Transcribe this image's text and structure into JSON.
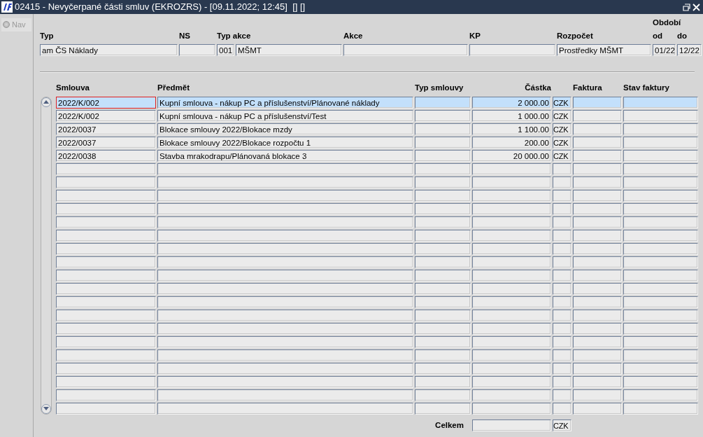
{
  "window": {
    "title": "02415 - Nevyčerpané části smluv (EKROZRS) - [09.11.2022; 12:45]  [] []"
  },
  "nav": {
    "label": "Nav",
    "disabled": true
  },
  "filter": {
    "period_label": "Období",
    "fields": [
      {
        "label": "Typ",
        "value": "am ČS Náklady"
      },
      {
        "label": "NS"
      },
      {
        "label": "Typ akce",
        "code": "001",
        "value": "MŠMT"
      },
      {
        "label": "Akce"
      },
      {
        "label": "KP"
      },
      {
        "label": "Rozpočet",
        "value": "Prostředky MŠMT"
      },
      {
        "label": "od",
        "value": "01/22"
      },
      {
        "label": "do",
        "value": "12/22"
      }
    ]
  },
  "table": {
    "columns": [
      {
        "label": "Smlouva"
      },
      {
        "label": "Předmět"
      },
      {
        "label": "Typ smlouvy"
      },
      {
        "label": "Částka"
      },
      {
        "label": "Faktura"
      },
      {
        "label": "Stav faktury"
      }
    ],
    "rows": [
      {
        "contract": "2022/K/002",
        "subject": "Kupní smlouva - nákup PC a příslušenství/Plánované náklady",
        "amount": "2 000.00",
        "currency": "CZK",
        "selected": true
      },
      {
        "contract": "2022/K/002",
        "subject": "Kupní smlouva - nákup PC a příslušenství/Test",
        "amount": "1 000.00",
        "currency": "CZK",
        "selected": false
      },
      {
        "contract": "2022/0037",
        "subject": "Blokace smlouvy 2022/Blokace mzdy",
        "amount": "1 100.00",
        "currency": "CZK",
        "selected": false
      },
      {
        "contract": "2022/0037",
        "subject": "Blokace smlouvy 2022/Blokace rozpočtu 1",
        "amount": "200.00",
        "currency": "CZK",
        "selected": false
      },
      {
        "contract": "2022/0038",
        "subject": "Stavba mrakodrapu/Plánovaná blokace 3",
        "amount": "20 000.00",
        "currency": "CZK",
        "selected": false
      }
    ]
  },
  "total": {
    "label": "Celkem",
    "currency": "CZK"
  }
}
